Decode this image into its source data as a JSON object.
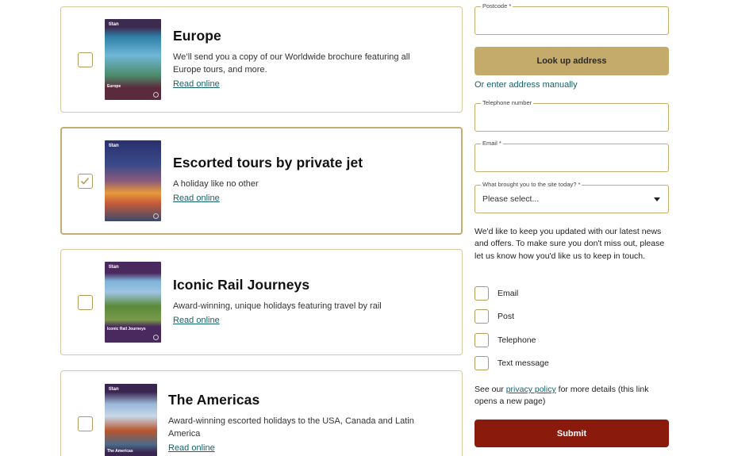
{
  "brochures": [
    {
      "title": "Europe",
      "description": "We’ll send you a copy of our Worldwide brochure featuring all Europe tours, and more.",
      "link": "Read online",
      "checked": false,
      "cover_logo": "titan",
      "cover_title": "Europe",
      "colors": {
        "top": "#3c2a4f",
        "mid": "#2f7fa8",
        "bottom": "#5c2a3d"
      }
    },
    {
      "title": "Escorted tours by private jet",
      "description": "A holiday like no other",
      "link": "Read online",
      "checked": true,
      "cover_logo": "titan",
      "cover_title": "",
      "colors": {
        "top": "#2a2f6e",
        "mid": "#d9823a",
        "bottom": "#3b4a6b"
      }
    },
    {
      "title": "Iconic Rail Journeys",
      "description": "Award-winning, unique holidays featuring travel by rail",
      "link": "Read online",
      "checked": false,
      "cover_logo": "titan",
      "cover_title": "Iconic Rail Journeys",
      "colors": {
        "top": "#4a2a5e",
        "mid": "#6a8a3a",
        "bottom": "#4a2a5e"
      }
    },
    {
      "title": "The Americas",
      "description": "Award-winning escorted holidays to the USA, Canada and Latin America",
      "link": "Read online",
      "checked": false,
      "cover_logo": "titan",
      "cover_title": "The Americas",
      "colors": {
        "top": "#3a2450",
        "mid": "#b8552d",
        "bottom": "#3a2450"
      }
    }
  ],
  "form": {
    "postcode_label": "Postcode *",
    "postcode_value": "",
    "lookup_button": "Look up address",
    "manual_link": "Or enter address manually",
    "telephone_label": "Telephone number",
    "telephone_value": "",
    "email_label": "Email *",
    "email_value": "",
    "source_label": "What brought you to the site today? *",
    "source_value": "Please select...",
    "consent_text": "We'd like to keep you updated with our latest news and offers. To make sure you don't miss out, please let us know how you'd like us to keep in touch.",
    "options": [
      "Email",
      "Post",
      "Telephone",
      "Text message"
    ],
    "privacy_prefix": "See our ",
    "privacy_link": "privacy policy",
    "privacy_suffix": " for more details (this link opens a new page)",
    "submit_button": "Submit"
  },
  "colors": {
    "accent_gold": "#c4ab6b",
    "link_teal": "#17636b",
    "submit_red": "#8a1a0c"
  }
}
